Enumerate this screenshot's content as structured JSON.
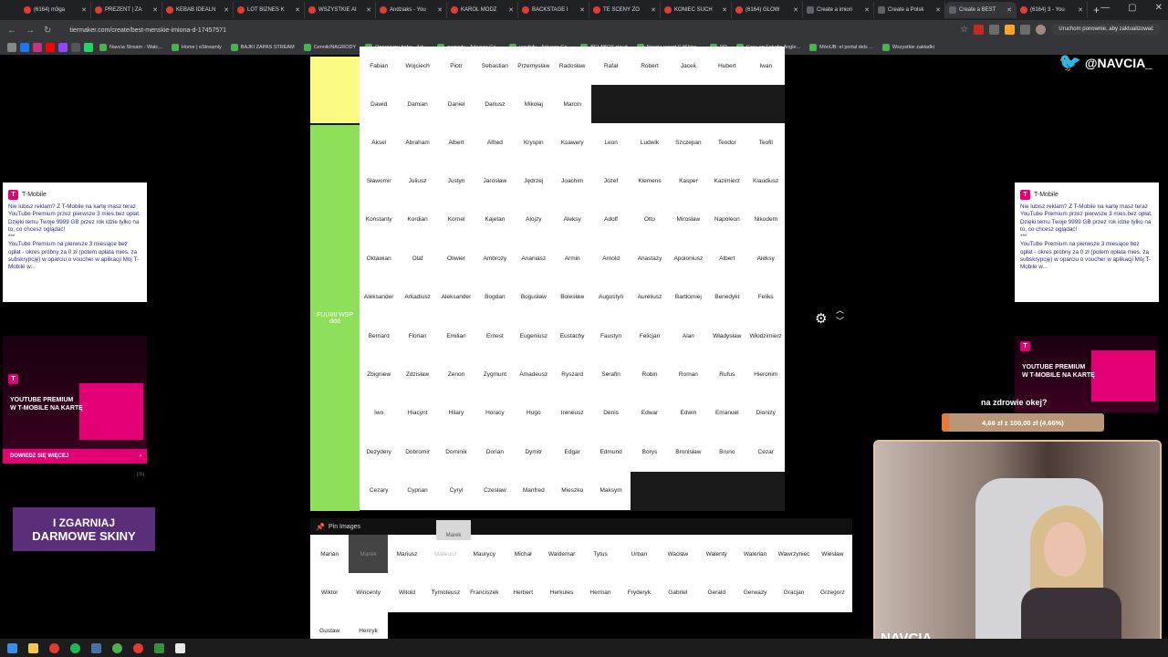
{
  "browser": {
    "tabs": [
      {
        "label": "(6164) m3ga",
        "active": false
      },
      {
        "label": "PREZENT | ZA",
        "active": false
      },
      {
        "label": "KEBAB IDEALN",
        "active": false
      },
      {
        "label": "LOT BIZNES K",
        "active": false
      },
      {
        "label": "WSZYSTKIE AI",
        "active": false
      },
      {
        "label": "Andziaks - You",
        "active": false
      },
      {
        "label": "KAROL MODZ",
        "active": false
      },
      {
        "label": "BACKSTAGE I",
        "active": false
      },
      {
        "label": "TE SCENY ZO",
        "active": false
      },
      {
        "label": "KONIEC SUCH",
        "active": false
      },
      {
        "label": "(6164) GLOW",
        "active": false
      },
      {
        "label": "Create a imion",
        "active": false
      },
      {
        "label": "Create a Polsk",
        "active": false
      },
      {
        "label": "Create a BEST",
        "active": true
      },
      {
        "label": "(6164) 3 - You",
        "active": false
      }
    ],
    "url": "tiermaker.com/create/best-menskie-imiona-d-17457571",
    "update_label": "Uruchom ponownie, aby zaktualizować",
    "bookmarks": [
      "Navcia Stream - Watc...",
      "Home | eStreamly",
      "BAJKI ZAPAS STREAM",
      "Cennik/NAGRODY",
      "Ogarniemy hehe - Ark...",
      "nagrody - Arkusze Go...",
      "uwufufu - Arkusze Go...",
      "BELABOX cloud",
      "Navcia report G4Skins...",
      "DP",
      "Grau en Estudis Angle...",
      "MónUB: el portal dels ...",
      "Wszystkie zakładki"
    ]
  },
  "tier_list": {
    "tier1_rows": [
      [
        "Fabian",
        "Wojciech",
        "Piotr",
        "Sebastian",
        "Przemysław",
        "Radosław",
        "Rafał",
        "Robert",
        "Jacek",
        "Hubert",
        "Iwan"
      ],
      [
        "Dawid",
        "Damian",
        "Daniel",
        "Dariusz",
        "Mikołaj",
        "Marcin"
      ]
    ],
    "tier2_label_line1": "FUUIIII WSP",
    "tier2_label_line2": "ddd",
    "tier2_rows": [
      [
        "Aksel",
        "Abraham",
        "Albert",
        "Alfred",
        "Kryspin",
        "Ksawery",
        "Leon",
        "Ludwik",
        "Szczepan",
        "Teodor",
        "Teofil"
      ],
      [
        "Sławomir",
        "Juliusz",
        "Justyn",
        "Jarosław",
        "Jędrzej",
        "Joachim",
        "Józef",
        "Klemens",
        "Kasper",
        "Kazimierz",
        "Klaudiusz"
      ],
      [
        "Konstanty",
        "Kordian",
        "Kornel",
        "Kajetan",
        "Alojzy",
        "Aleksy",
        "Adolf",
        "Otto",
        "Mirosław",
        "Napoleon",
        "Nikodem"
      ],
      [
        "Oktawian",
        "Olaf",
        "Oliwier",
        "Ambroży",
        "Ananiasz",
        "Armin",
        "Arnold",
        "Anastazy",
        "Apoloniusz",
        "Albert",
        "Aleksy"
      ],
      [
        "Aleksander",
        "Arkadiusz",
        "Aleksander",
        "Bogdan",
        "Bogusław",
        "Bolesław",
        "Augustyn",
        "Aureliusz",
        "Bartłomiej",
        "Benedykt",
        "Feliks"
      ],
      [
        "Bernard",
        "Florian",
        "Emilian",
        "Ernest",
        "Eugeniusz",
        "Eustachy",
        "Faustyn",
        "Felicjan",
        "Alan",
        "Władysław",
        "Włodzimierz"
      ],
      [
        "Zbigniew",
        "Zdzisław",
        "Zenon",
        "Zygmunt",
        "Amadeusz",
        "Ryszard",
        "Serafin",
        "Robin",
        "Roman",
        "Rufus",
        "Hieronim"
      ],
      [
        "Iwo",
        "Hiacynt",
        "Hilary",
        "Horacy",
        "Hugo",
        "Ireneusz",
        "Denis",
        "Edwar",
        "Edwin",
        "Emanuel",
        "Dionizy"
      ],
      [
        "Dezydery",
        "Dobromir",
        "Dominik",
        "Dorian",
        "Dymitr",
        "Edgar",
        "Edmund",
        "Borys",
        "Bronisław",
        "Bruno",
        "Cezar"
      ],
      [
        "Cezary",
        "Cyprian",
        "Cyryl",
        "Czesław",
        "Manfred",
        "Mieszko",
        "Maksym"
      ]
    ]
  },
  "pin_images": {
    "label": "Pin Images",
    "dragging_label": "Marek",
    "rows": [
      [
        "Marian",
        "Marek",
        "Mariusz",
        "Mateusz",
        "Maurycy",
        "Michał",
        "Waldemar",
        "Tytus",
        "Urban",
        "Wacław",
        "Walenty",
        "Walerian",
        "Wawrzyniec",
        "Wiesław"
      ],
      [
        "Wiktor",
        "Wincenty",
        "Witold",
        "Tymoteusz",
        "Franciszek",
        "Herbert",
        "Herkules",
        "Herman",
        "Fryderyk",
        "Gabriel",
        "Gerald",
        "Gerwazy",
        "Gracjan",
        "Grzegorz"
      ],
      [
        "Gustaw",
        "Henryk"
      ]
    ]
  },
  "ads": {
    "brand": "T-Mobile",
    "text1": "Nie lubisz reklam? Z T-Mobile na kartę masz teraz YouTube Premium przez pierwsze 3 mies.bez opłat. Dzięki temu Twoje 9999 GB przez rok idzie tylko na to, co chcesz oglądać!",
    "text_sep": "***",
    "text2": "YouTube Premium na pierwsze 3 miesiące bez opłat - okres próbny za 0 zł (potem opłata mies. za subskrypcję) w oparciu o voucher w aplikacji Mój T-Mobile w...",
    "banner_title_1": "YOUTUBE PREMIUM",
    "banner_title_2": "W T-MOBILE NA KARTĘ",
    "more_label": "DOWIEDZ SIĘ WIĘCEJ",
    "pn": "PN"
  },
  "overlay": {
    "skins_line1": "I ZGARNIAJ",
    "skins_line2": "DARMOWE SKINY",
    "twitter_handle": "@NAVCIA_",
    "goal_title": "na zdrowie okej?",
    "goal_text": "4,66 zł z 100,00 zł (4.66%)",
    "goal_progress": 0.0466,
    "cam_name": "NAVCIA"
  }
}
